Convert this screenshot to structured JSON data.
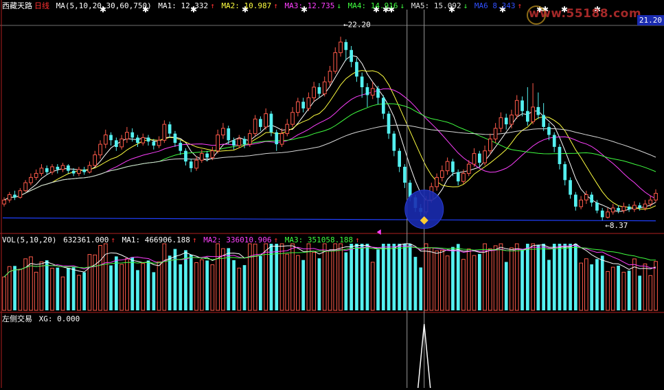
{
  "header": {
    "stock_name": "西藏天路",
    "period": "日线",
    "ma_params": "MA(5,10,20,30,60,750)",
    "ma1": "MA1: 12.332",
    "ma1_arrow": "↑",
    "ma2": "MA2: 10.987",
    "ma2_arrow": "↑",
    "ma3": "MA3: 12.735",
    "ma3_arrow": "↓",
    "ma4": "MA4: 14.916",
    "ma4_arrow": "↓",
    "ma5": "MA5: 15.092",
    "ma5_arrow": "↓",
    "ma6": "MA6  8.343",
    "ma6_arrow": "↑"
  },
  "watermark": "www.55188.com",
  "price_tag": "21.20",
  "price_high_label": "22.20",
  "price_low_label": "8.37",
  "vol_header": {
    "params": "VOL(5,10,20)",
    "value": "632361.000",
    "ma1": "MA1: 466906.188",
    "ma2": "MA2: 336010.906",
    "ma3": "MA3: 351058.188",
    "arrow": "↑"
  },
  "indicator_header": {
    "name": "左侧交易",
    "xg": "XG: 0.000"
  },
  "colors": {
    "up": "#ff5a4a",
    "down": "#54f0f0",
    "ma1": "#ffffff",
    "ma2": "#ffff40",
    "ma3": "#ff40ff",
    "ma4": "#40ff40",
    "ma5": "#d8d8d8",
    "ma6": "#2040ff",
    "circle": "#1a2bb0"
  },
  "chart_data": {
    "type": "candlestick",
    "price_range": [
      8.0,
      23.0
    ],
    "candles": [
      {
        "o": 9.6,
        "c": 9.9,
        "h": 10.1,
        "l": 9.4
      },
      {
        "o": 9.9,
        "c": 10.3,
        "h": 10.5,
        "l": 9.7
      },
      {
        "o": 10.3,
        "c": 10.1,
        "h": 10.6,
        "l": 9.9
      },
      {
        "o": 10.1,
        "c": 10.6,
        "h": 10.8,
        "l": 10.0
      },
      {
        "o": 10.6,
        "c": 11.2,
        "h": 11.4,
        "l": 10.5
      },
      {
        "o": 11.2,
        "c": 11.6,
        "h": 11.9,
        "l": 11.0
      },
      {
        "o": 11.6,
        "c": 11.9,
        "h": 12.2,
        "l": 11.4
      },
      {
        "o": 11.9,
        "c": 12.3,
        "h": 12.6,
        "l": 11.7
      },
      {
        "o": 12.3,
        "c": 12.0,
        "h": 12.5,
        "l": 11.8
      },
      {
        "o": 12.0,
        "c": 12.4,
        "h": 12.6,
        "l": 11.8
      },
      {
        "o": 12.4,
        "c": 12.2,
        "h": 12.6,
        "l": 11.9
      },
      {
        "o": 12.2,
        "c": 12.5,
        "h": 12.7,
        "l": 12.0
      },
      {
        "o": 12.5,
        "c": 12.1,
        "h": 12.6,
        "l": 11.9
      },
      {
        "o": 12.1,
        "c": 11.9,
        "h": 12.3,
        "l": 11.7
      },
      {
        "o": 11.9,
        "c": 12.2,
        "h": 12.4,
        "l": 11.7
      },
      {
        "o": 12.2,
        "c": 12.0,
        "h": 12.4,
        "l": 11.8
      },
      {
        "o": 12.0,
        "c": 12.5,
        "h": 12.8,
        "l": 11.9
      },
      {
        "o": 12.5,
        "c": 13.3,
        "h": 13.6,
        "l": 12.4
      },
      {
        "o": 13.3,
        "c": 14.1,
        "h": 14.4,
        "l": 13.0
      },
      {
        "o": 14.1,
        "c": 14.8,
        "h": 15.2,
        "l": 13.8
      },
      {
        "o": 14.8,
        "c": 14.4,
        "h": 15.0,
        "l": 14.0
      },
      {
        "o": 14.4,
        "c": 13.9,
        "h": 14.6,
        "l": 13.6
      },
      {
        "o": 13.9,
        "c": 14.5,
        "h": 14.8,
        "l": 13.7
      },
      {
        "o": 14.5,
        "c": 15.0,
        "h": 15.4,
        "l": 14.2
      },
      {
        "o": 15.0,
        "c": 14.6,
        "h": 15.3,
        "l": 14.3
      },
      {
        "o": 14.6,
        "c": 14.2,
        "h": 14.8,
        "l": 13.9
      },
      {
        "o": 14.2,
        "c": 14.6,
        "h": 14.9,
        "l": 14.0
      },
      {
        "o": 14.6,
        "c": 14.3,
        "h": 14.8,
        "l": 14.0
      },
      {
        "o": 14.3,
        "c": 14.0,
        "h": 14.5,
        "l": 13.7
      },
      {
        "o": 14.0,
        "c": 14.4,
        "h": 14.7,
        "l": 13.8
      },
      {
        "o": 14.4,
        "c": 15.6,
        "h": 15.9,
        "l": 14.2
      },
      {
        "o": 15.6,
        "c": 14.9,
        "h": 15.8,
        "l": 14.6
      },
      {
        "o": 14.9,
        "c": 14.2,
        "h": 15.1,
        "l": 13.9
      },
      {
        "o": 14.2,
        "c": 13.6,
        "h": 14.4,
        "l": 13.3
      },
      {
        "o": 13.6,
        "c": 12.8,
        "h": 13.8,
        "l": 12.5
      },
      {
        "o": 12.8,
        "c": 12.3,
        "h": 13.0,
        "l": 12.0
      },
      {
        "o": 12.3,
        "c": 12.9,
        "h": 13.2,
        "l": 12.1
      },
      {
        "o": 12.9,
        "c": 13.4,
        "h": 13.7,
        "l": 12.7
      },
      {
        "o": 13.4,
        "c": 13.1,
        "h": 13.6,
        "l": 12.8
      },
      {
        "o": 13.1,
        "c": 13.6,
        "h": 13.9,
        "l": 12.9
      },
      {
        "o": 13.6,
        "c": 14.8,
        "h": 15.2,
        "l": 13.4
      },
      {
        "o": 14.8,
        "c": 15.3,
        "h": 15.7,
        "l": 14.5
      },
      {
        "o": 15.3,
        "c": 14.4,
        "h": 15.5,
        "l": 14.1
      },
      {
        "o": 14.4,
        "c": 14.0,
        "h": 14.6,
        "l": 13.7
      },
      {
        "o": 14.0,
        "c": 14.5,
        "h": 14.8,
        "l": 13.8
      },
      {
        "o": 14.5,
        "c": 14.1,
        "h": 14.7,
        "l": 13.8
      },
      {
        "o": 14.1,
        "c": 14.9,
        "h": 15.2,
        "l": 13.9
      },
      {
        "o": 14.9,
        "c": 16.0,
        "h": 16.3,
        "l": 14.7
      },
      {
        "o": 16.0,
        "c": 15.4,
        "h": 16.2,
        "l": 15.1
      },
      {
        "o": 15.4,
        "c": 16.4,
        "h": 16.8,
        "l": 15.2
      },
      {
        "o": 16.4,
        "c": 15.0,
        "h": 16.6,
        "l": 14.7
      },
      {
        "o": 15.0,
        "c": 14.1,
        "h": 15.2,
        "l": 13.6
      },
      {
        "o": 14.1,
        "c": 14.9,
        "h": 15.3,
        "l": 13.9
      },
      {
        "o": 14.9,
        "c": 15.6,
        "h": 16.0,
        "l": 14.7
      },
      {
        "o": 15.6,
        "c": 16.5,
        "h": 16.9,
        "l": 15.4
      },
      {
        "o": 16.5,
        "c": 17.3,
        "h": 17.6,
        "l": 16.2
      },
      {
        "o": 17.3,
        "c": 16.8,
        "h": 17.6,
        "l": 16.5
      },
      {
        "o": 16.8,
        "c": 17.6,
        "h": 18.0,
        "l": 16.6
      },
      {
        "o": 17.6,
        "c": 18.4,
        "h": 18.8,
        "l": 17.3
      },
      {
        "o": 18.4,
        "c": 17.9,
        "h": 18.7,
        "l": 17.6
      },
      {
        "o": 17.9,
        "c": 18.8,
        "h": 19.2,
        "l": 17.7
      },
      {
        "o": 18.8,
        "c": 19.6,
        "h": 20.0,
        "l": 18.5
      },
      {
        "o": 19.6,
        "c": 21.0,
        "h": 21.4,
        "l": 19.4
      },
      {
        "o": 21.0,
        "c": 21.8,
        "h": 22.2,
        "l": 20.7
      },
      {
        "o": 21.8,
        "c": 21.2,
        "h": 22.0,
        "l": 20.4
      },
      {
        "o": 21.2,
        "c": 20.3,
        "h": 21.5,
        "l": 19.9
      },
      {
        "o": 20.3,
        "c": 19.2,
        "h": 20.6,
        "l": 18.8
      },
      {
        "o": 19.2,
        "c": 18.4,
        "h": 19.5,
        "l": 17.6
      },
      {
        "o": 18.4,
        "c": 17.8,
        "h": 18.7,
        "l": 16.9
      },
      {
        "o": 17.8,
        "c": 18.3,
        "h": 18.8,
        "l": 17.5
      },
      {
        "o": 18.3,
        "c": 17.6,
        "h": 18.5,
        "l": 17.1
      },
      {
        "o": 17.6,
        "c": 16.4,
        "h": 17.8,
        "l": 16.0
      },
      {
        "o": 16.4,
        "c": 14.9,
        "h": 16.6,
        "l": 14.5
      },
      {
        "o": 14.9,
        "c": 13.6,
        "h": 15.1,
        "l": 13.2
      },
      {
        "o": 13.6,
        "c": 12.4,
        "h": 13.8,
        "l": 12.0
      },
      {
        "o": 12.4,
        "c": 11.2,
        "h": 12.6,
        "l": 10.8
      },
      {
        "o": 11.2,
        "c": 10.1,
        "h": 11.4,
        "l": 9.8
      },
      {
        "o": 10.1,
        "c": 9.3,
        "h": 10.3,
        "l": 9.0
      },
      {
        "o": 9.3,
        "c": 9.0,
        "h": 9.6,
        "l": 8.7
      },
      {
        "o": 9.0,
        "c": 9.9,
        "h": 10.2,
        "l": 8.8
      },
      {
        "o": 9.9,
        "c": 10.9,
        "h": 11.2,
        "l": 9.7
      },
      {
        "o": 10.9,
        "c": 11.6,
        "h": 11.9,
        "l": 10.6
      },
      {
        "o": 11.6,
        "c": 12.1,
        "h": 12.5,
        "l": 11.3
      },
      {
        "o": 12.1,
        "c": 12.8,
        "h": 13.1,
        "l": 11.8
      },
      {
        "o": 12.8,
        "c": 12.0,
        "h": 13.0,
        "l": 11.7
      },
      {
        "o": 12.0,
        "c": 11.3,
        "h": 12.2,
        "l": 11.0
      },
      {
        "o": 11.3,
        "c": 11.9,
        "h": 12.2,
        "l": 11.1
      },
      {
        "o": 11.9,
        "c": 12.6,
        "h": 12.9,
        "l": 11.7
      },
      {
        "o": 12.6,
        "c": 13.4,
        "h": 13.8,
        "l": 12.4
      },
      {
        "o": 13.4,
        "c": 12.7,
        "h": 13.6,
        "l": 12.4
      },
      {
        "o": 12.7,
        "c": 13.6,
        "h": 14.0,
        "l": 12.5
      },
      {
        "o": 13.6,
        "c": 14.5,
        "h": 14.9,
        "l": 13.3
      },
      {
        "o": 14.5,
        "c": 15.3,
        "h": 15.7,
        "l": 14.2
      },
      {
        "o": 15.3,
        "c": 16.1,
        "h": 16.5,
        "l": 15.0
      },
      {
        "o": 16.1,
        "c": 15.6,
        "h": 16.4,
        "l": 15.2
      },
      {
        "o": 15.6,
        "c": 16.3,
        "h": 16.7,
        "l": 15.3
      },
      {
        "o": 16.3,
        "c": 17.4,
        "h": 17.8,
        "l": 16.0
      },
      {
        "o": 17.4,
        "c": 16.6,
        "h": 17.7,
        "l": 16.2
      },
      {
        "o": 16.6,
        "c": 15.8,
        "h": 18.4,
        "l": 15.5
      },
      {
        "o": 15.8,
        "c": 16.9,
        "h": 18.7,
        "l": 15.6
      },
      {
        "o": 16.9,
        "c": 16.3,
        "h": 18.0,
        "l": 16.0
      },
      {
        "o": 16.3,
        "c": 15.4,
        "h": 17.2,
        "l": 15.1
      },
      {
        "o": 15.4,
        "c": 14.8,
        "h": 15.7,
        "l": 14.4
      },
      {
        "o": 14.8,
        "c": 13.9,
        "h": 15.0,
        "l": 13.5
      },
      {
        "o": 13.9,
        "c": 12.6,
        "h": 14.1,
        "l": 12.2
      },
      {
        "o": 12.6,
        "c": 11.4,
        "h": 12.8,
        "l": 11.0
      },
      {
        "o": 11.4,
        "c": 10.3,
        "h": 11.6,
        "l": 10.0
      },
      {
        "o": 10.3,
        "c": 9.4,
        "h": 10.5,
        "l": 9.1
      },
      {
        "o": 9.4,
        "c": 9.9,
        "h": 10.2,
        "l": 9.2
      },
      {
        "o": 9.9,
        "c": 10.3,
        "h": 10.6,
        "l": 9.6
      },
      {
        "o": 10.3,
        "c": 9.7,
        "h": 10.5,
        "l": 9.4
      },
      {
        "o": 9.7,
        "c": 9.1,
        "h": 9.9,
        "l": 8.9
      },
      {
        "o": 9.1,
        "c": 8.6,
        "h": 9.3,
        "l": 8.37
      },
      {
        "o": 8.6,
        "c": 9.0,
        "h": 9.3,
        "l": 8.5
      },
      {
        "o": 9.0,
        "c": 9.3,
        "h": 9.6,
        "l": 8.8
      },
      {
        "o": 9.3,
        "c": 9.1,
        "h": 9.5,
        "l": 8.9
      },
      {
        "o": 9.1,
        "c": 9.4,
        "h": 9.7,
        "l": 8.9
      },
      {
        "o": 9.4,
        "c": 9.2,
        "h": 9.6,
        "l": 9.0
      },
      {
        "o": 9.2,
        "c": 9.5,
        "h": 9.8,
        "l": 9.0
      },
      {
        "o": 9.5,
        "c": 9.3,
        "h": 9.7,
        "l": 9.1
      },
      {
        "o": 9.3,
        "c": 9.6,
        "h": 9.9,
        "l": 9.1
      },
      {
        "o": 9.6,
        "c": 9.9,
        "h": 10.2,
        "l": 9.4
      },
      {
        "o": 9.9,
        "c": 10.4,
        "h": 10.7,
        "l": 9.7
      }
    ],
    "volume_note": "volume bars follow candle color"
  }
}
